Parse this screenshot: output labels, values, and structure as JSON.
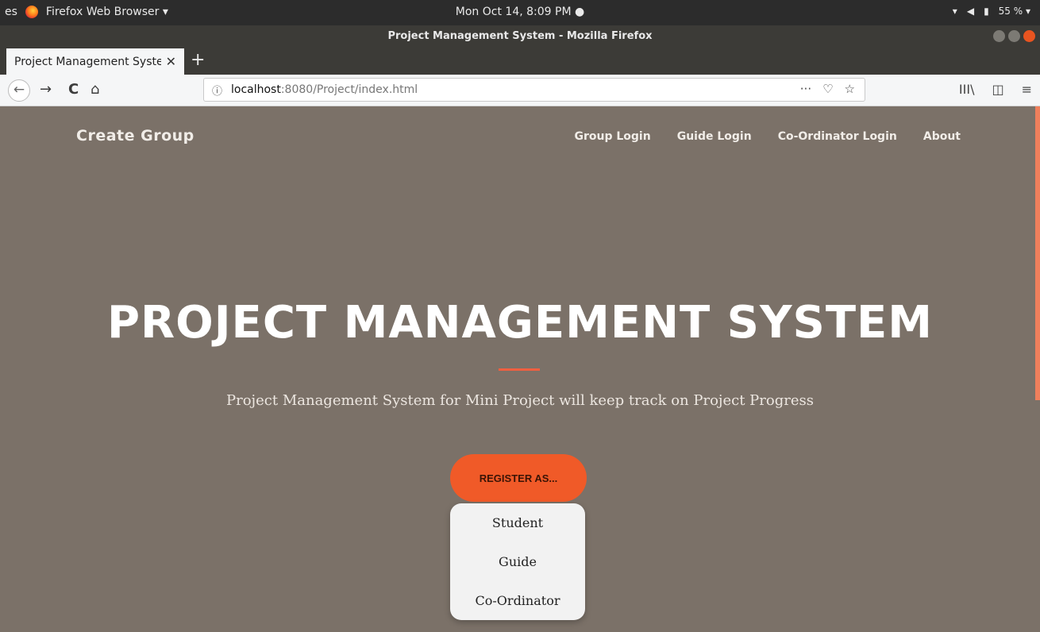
{
  "system_bar": {
    "activities_fragment": "es",
    "app_name": "Firefox Web Browser ▾",
    "datetime": "Mon Oct 14, 8:09 PM ●",
    "battery": "55 % ▾"
  },
  "window": {
    "title": "Project Management System - Mozilla Firefox"
  },
  "tabs": [
    {
      "title": "Project Management Syster",
      "close": "✕"
    }
  ],
  "new_tab": "+",
  "navbar": {
    "back": "←",
    "forward": "→",
    "reload": "C",
    "home": "⌂",
    "info": "ⓘ",
    "url_host": "localhost",
    "url_rest": ":8080/Project/index.html",
    "more": "···",
    "pocket": "♡",
    "bookmark": "☆",
    "library": "III\\",
    "sidebar": "◫",
    "menu": "≡"
  },
  "site": {
    "brand": "Create Group",
    "menu": [
      "Group Login",
      "Guide Login",
      "Co-Ordinator Login",
      "About"
    ],
    "hero_title": "PROJECT MANAGEMENT SYSTEM",
    "subtitle": "Project Management System for Mini Project will keep track on Project Progress",
    "register_label": "REGISTER AS...",
    "dropdown": [
      "Student",
      "Guide",
      "Co-Ordinator"
    ]
  },
  "colors": {
    "page_bg": "#7b7168",
    "accent": "#f05a28"
  }
}
